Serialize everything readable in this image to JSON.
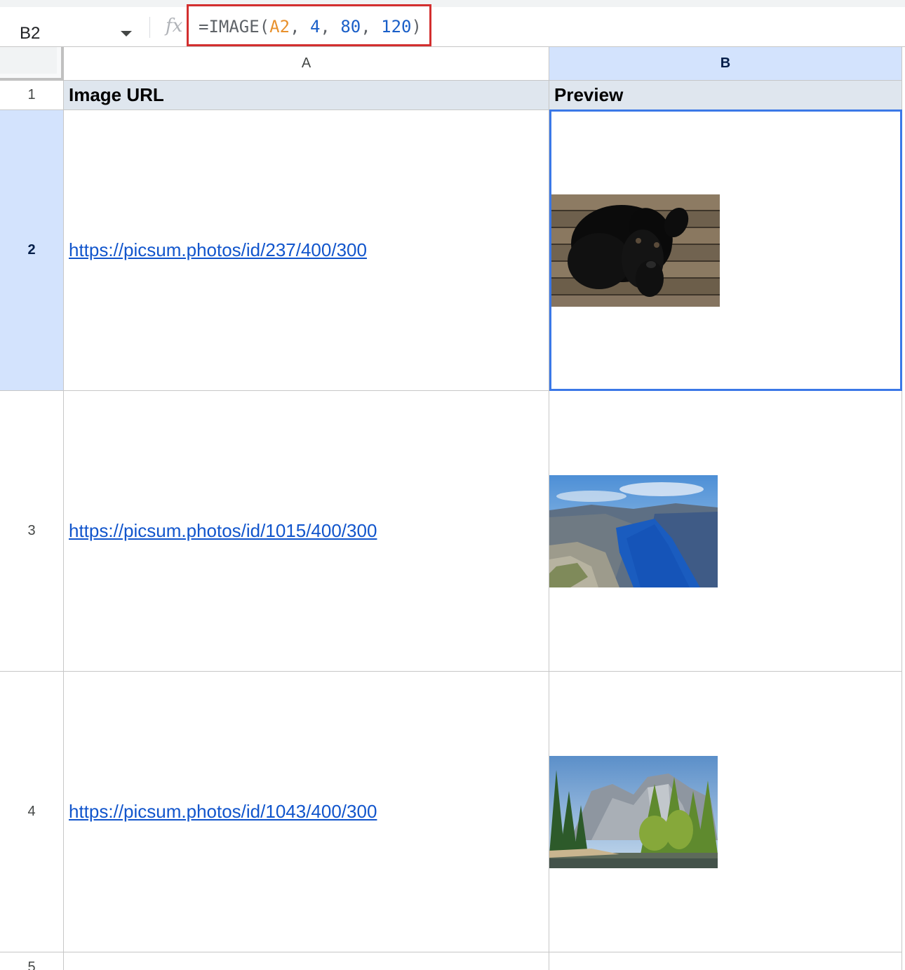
{
  "formula_bar": {
    "cell_ref": "B2",
    "fx_label": "fx",
    "formula": {
      "prefix": "=IMAGE(",
      "ref": "A2",
      "sep1": ", ",
      "arg_mode": "4",
      "sep2": ", ",
      "arg_height": "80",
      "sep3": ", ",
      "arg_width": "120",
      "suffix": ")"
    }
  },
  "columns": [
    {
      "label": "A",
      "selected": false
    },
    {
      "label": "B",
      "selected": true
    }
  ],
  "rows": [
    "1",
    "2",
    "3",
    "4",
    "5"
  ],
  "sheet": {
    "header": {
      "a": "Image URL",
      "b": "Preview"
    },
    "data": [
      {
        "url": "https://picsum.photos/id/237/400/300",
        "preview": "black-puppy-on-wood-image"
      },
      {
        "url": "https://picsum.photos/id/1015/400/300",
        "preview": "fjord-river-canyon-image"
      },
      {
        "url": "https://picsum.photos/id/1043/400/300",
        "preview": "mountain-forest-lake-image"
      }
    ]
  },
  "colors": {
    "selection": "#3b78e7",
    "header_fill": "#dfe6ee",
    "selected_header": "#d3e3fd",
    "link": "#1155cc",
    "highlight_box": "#d32f2f"
  }
}
